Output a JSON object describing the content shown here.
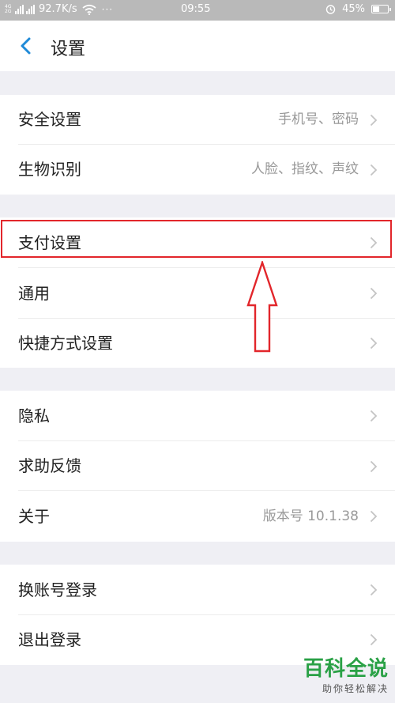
{
  "status_bar": {
    "net_top": "4G",
    "net_bottom": "2G",
    "speed": "92.7K/s",
    "dots": "···",
    "time": "09:55",
    "battery": "45%",
    "battery_level": 0.45
  },
  "header": {
    "title": "设置"
  },
  "sections": [
    {
      "items": [
        {
          "label": "安全设置",
          "value": "手机号、密码"
        },
        {
          "label": "生物识别",
          "value": "人脸、指纹、声纹"
        }
      ]
    },
    {
      "items": [
        {
          "label": "支付设置",
          "value": ""
        },
        {
          "label": "通用",
          "value": ""
        },
        {
          "label": "快捷方式设置",
          "value": ""
        }
      ]
    },
    {
      "items": [
        {
          "label": "隐私",
          "value": ""
        },
        {
          "label": "求助反馈",
          "value": ""
        },
        {
          "label": "关于",
          "value": "版本号 10.1.38"
        }
      ]
    },
    {
      "items": [
        {
          "label": "换账号登录",
          "value": ""
        },
        {
          "label": "退出登录",
          "value": ""
        }
      ]
    }
  ],
  "annotation": {
    "highlight_color": "#e2262b"
  },
  "watermark": {
    "main": "百科全说",
    "sub": "助你轻松解决"
  },
  "colors": {
    "accent": "#1f8ad8",
    "background": "#efeff4",
    "watermark": "#2aa146"
  }
}
